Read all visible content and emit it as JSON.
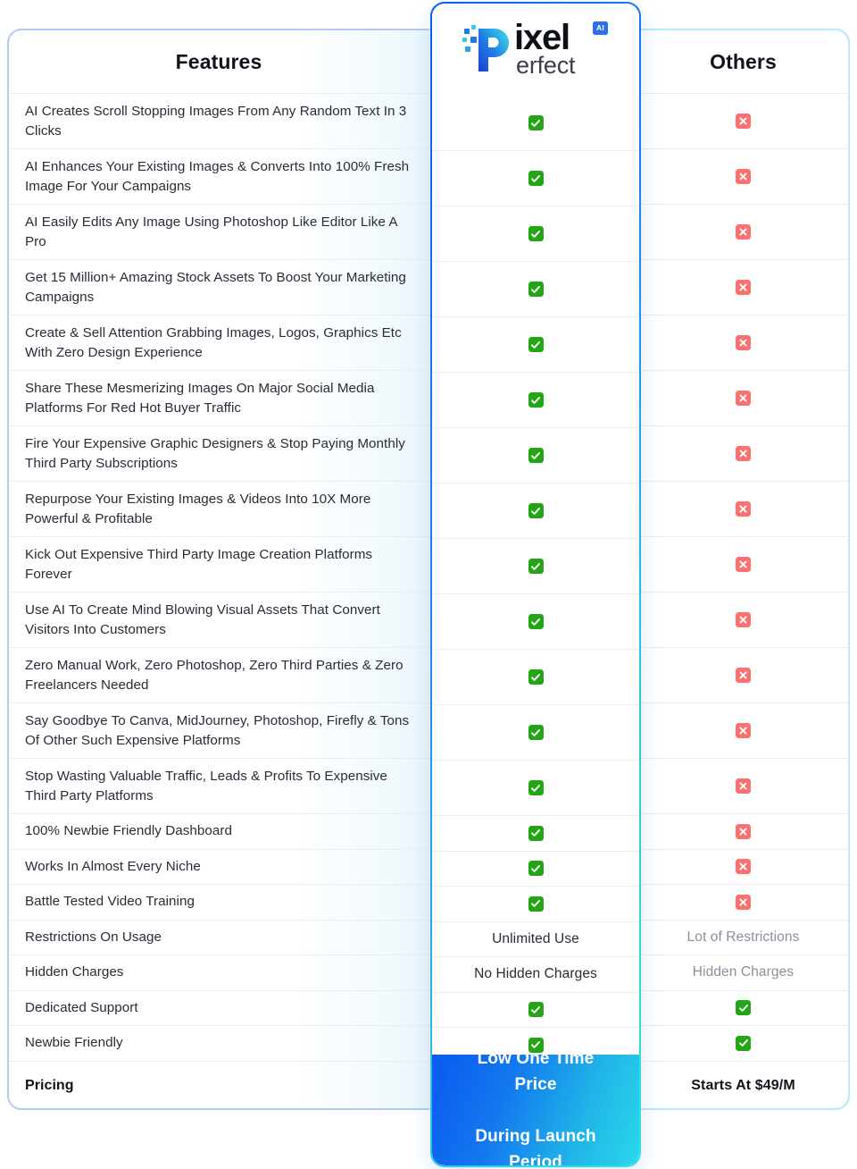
{
  "table": {
    "columns": {
      "features_label": "Features",
      "product_label": "Pixel Perfect",
      "others_label": "Others"
    },
    "logo": {
      "word_main": "ixel",
      "word_sub": "erfect",
      "badge": "AI"
    },
    "rows": [
      {
        "feature": "AI Creates Scroll Stopping Images From Any Random Text In 3 Clicks",
        "product": "check",
        "others": "cross",
        "lines": 2
      },
      {
        "feature": "AI Enhances Your Existing Images & Converts Into 100% Fresh Image For Your Campaigns",
        "product": "check",
        "others": "cross",
        "lines": 2
      },
      {
        "feature": "AI Easily Edits Any Image Using Photoshop Like Editor Like A Pro",
        "product": "check",
        "others": "cross",
        "lines": 2
      },
      {
        "feature": "Get 15 Million+ Amazing Stock Assets To Boost Your Marketing Campaigns",
        "product": "check",
        "others": "cross",
        "lines": 2
      },
      {
        "feature": "Create & Sell Attention Grabbing Images, Logos, Graphics Etc With Zero Design Experience",
        "product": "check",
        "others": "cross",
        "lines": 2
      },
      {
        "feature": "Share These Mesmerizing Images On Major Social Media Platforms For Red Hot Buyer Traffic",
        "product": "check",
        "others": "cross",
        "lines": 2
      },
      {
        "feature": "Fire Your Expensive Graphic Designers & Stop Paying Monthly Third Party Subscriptions",
        "product": "check",
        "others": "cross",
        "lines": 2
      },
      {
        "feature": "Repurpose Your Existing Images & Videos Into 10X More Powerful & Profitable",
        "product": "check",
        "others": "cross",
        "lines": 2
      },
      {
        "feature": "Kick Out Expensive Third Party Image Creation Platforms Forever",
        "product": "check",
        "others": "cross",
        "lines": 2
      },
      {
        "feature": "Use AI To Create Mind Blowing Visual Assets That Convert Visitors Into Customers",
        "product": "check",
        "others": "cross",
        "lines": 2
      },
      {
        "feature": "Zero Manual Work, Zero Photoshop, Zero Third Parties & Zero Freelancers Needed",
        "product": "check",
        "others": "cross",
        "lines": 2
      },
      {
        "feature": "Say Goodbye To Canva, MidJourney, Photoshop, Firefly & Tons Of Other Such Expensive Platforms",
        "product": "check",
        "others": "cross",
        "lines": 2
      },
      {
        "feature": "Stop Wasting Valuable Traffic, Leads & Profits To Expensive Third Party Platforms",
        "product": "check",
        "others": "cross",
        "lines": 2
      },
      {
        "feature": "100% Newbie Friendly Dashboard",
        "product": "check",
        "others": "cross",
        "lines": 1
      },
      {
        "feature": "Works In Almost Every Niche",
        "product": "check",
        "others": "cross",
        "lines": 1
      },
      {
        "feature": "Battle Tested Video Training",
        "product": "check",
        "others": "cross",
        "lines": 1
      },
      {
        "feature": "Restrictions On Usage",
        "product": "Unlimited Use",
        "others": "Lot of Restrictions",
        "lines": 1
      },
      {
        "feature": "Hidden Charges",
        "product": "No Hidden Charges",
        "others": "Hidden Charges",
        "lines": 1
      },
      {
        "feature": "Dedicated Support",
        "product": "check",
        "others": "check",
        "lines": 1
      },
      {
        "feature": "Newbie Friendly",
        "product": "check",
        "others": "check",
        "lines": 1
      },
      {
        "feature": "Pricing",
        "product": "Low One Time Price During Launch Period",
        "others": "Starts At $49/M",
        "lines": 1,
        "bold": true
      }
    ],
    "pricing_banner": {
      "line1": "Low One Time Price",
      "line2": "During Launch Period"
    },
    "others_pricing": "Starts At $49/M"
  },
  "colors": {
    "check_green": "#23a515",
    "cross_red": "#fc7070",
    "brand_blue": "#0b59ef",
    "brand_cyan": "#2ad7ea",
    "border_periwinkle": "#b9c8f2",
    "border_cyan": "#b6ecf5"
  }
}
